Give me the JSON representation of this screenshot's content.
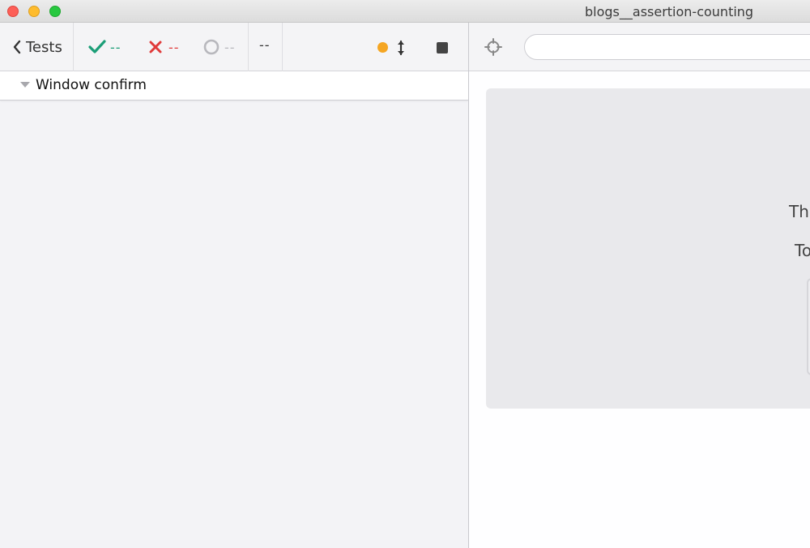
{
  "window": {
    "title": "blogs__assertion-counting"
  },
  "reporter": {
    "back_label": "Tests",
    "stats": {
      "passed": "--",
      "failed": "--",
      "pending": "--"
    },
    "duration": "--",
    "suites": [
      {
        "title": "Window confirm"
      }
    ]
  },
  "app": {
    "url_value": "",
    "visible_text": [
      "Th",
      "To"
    ]
  },
  "colors": {
    "passed": "#1b9e77",
    "failed": "#e03a3a",
    "pending": "#b8b8bd",
    "running_dot": "#f5a623"
  },
  "icons": {
    "back": "chevron-left-icon",
    "passed": "checkmark-icon",
    "failed": "x-icon",
    "pending": "spinner-circle-icon",
    "scroll": "vertical-arrows-icon",
    "stop": "stop-square-icon",
    "selector": "crosshair-icon"
  }
}
